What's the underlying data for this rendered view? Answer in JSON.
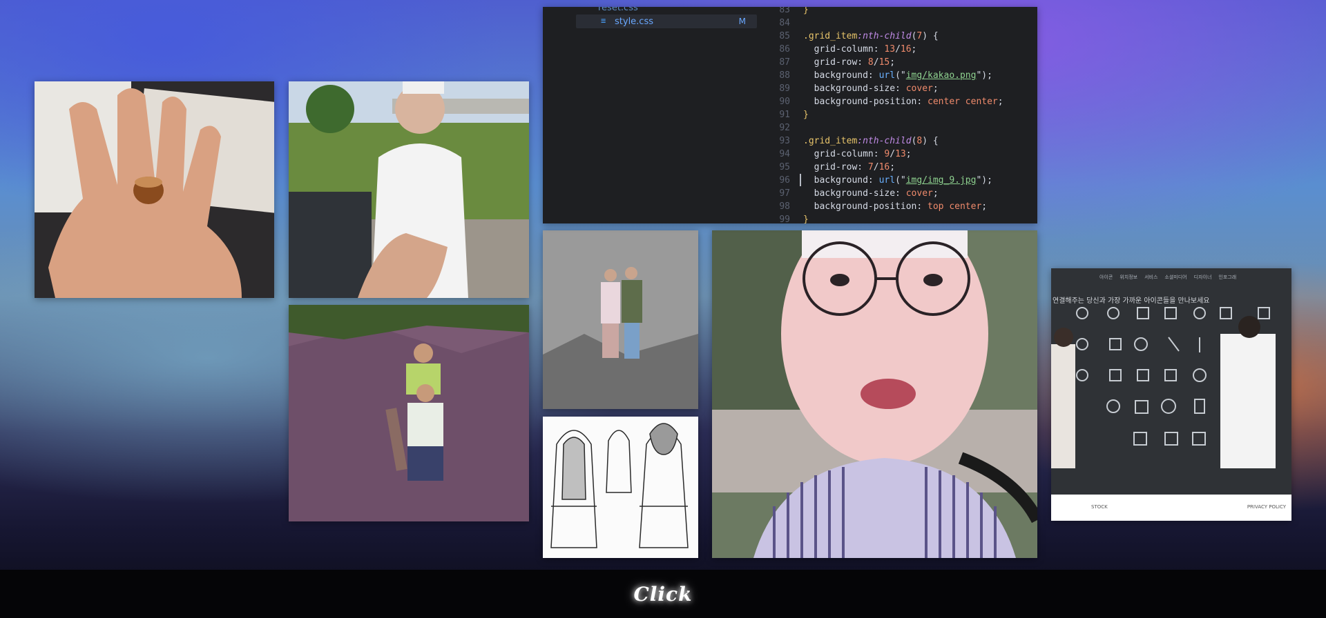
{
  "gallery": {
    "tiles": [
      {
        "name": "photo-hand-acorn"
      },
      {
        "name": "photo-riverbank-smile"
      },
      {
        "name": "photo-rocks-kids"
      },
      {
        "name": "photo-couple-rocks"
      },
      {
        "name": "sketch-coats"
      },
      {
        "name": "photo-selfie-glasses"
      },
      {
        "name": "screenshot-icon-site"
      }
    ]
  },
  "editor": {
    "explorer": {
      "top_partial": "reset.css",
      "file": "style.css",
      "git_status": "M"
    },
    "code_lines": [
      {
        "no": "83",
        "parts": [
          {
            "c": "t-brace",
            "t": "}"
          }
        ]
      },
      {
        "no": "84",
        "parts": []
      },
      {
        "no": "85",
        "parts": [
          {
            "c": "t-sel",
            "t": ".grid_item"
          },
          {
            "c": "t-pseudo",
            "t": ":nth-child"
          },
          {
            "c": "t-punc",
            "t": "("
          },
          {
            "c": "t-num",
            "t": "7"
          },
          {
            "c": "t-punc",
            "t": ") {"
          }
        ]
      },
      {
        "no": "86",
        "parts": [
          {
            "c": "t-prop",
            "t": "  grid-column: "
          },
          {
            "c": "t-num",
            "t": "13"
          },
          {
            "c": "t-punc",
            "t": "/"
          },
          {
            "c": "t-num",
            "t": "16"
          },
          {
            "c": "t-punc",
            "t": ";"
          }
        ]
      },
      {
        "no": "87",
        "parts": [
          {
            "c": "t-prop",
            "t": "  grid-row: "
          },
          {
            "c": "t-num",
            "t": "8"
          },
          {
            "c": "t-punc",
            "t": "/"
          },
          {
            "c": "t-num",
            "t": "15"
          },
          {
            "c": "t-punc",
            "t": ";"
          }
        ]
      },
      {
        "no": "88",
        "parts": [
          {
            "c": "t-prop",
            "t": "  background: "
          },
          {
            "c": "t-fn",
            "t": "url"
          },
          {
            "c": "t-punc",
            "t": "(\""
          },
          {
            "c": "t-str",
            "t": "img/kakao.png"
          },
          {
            "c": "t-punc",
            "t": "\");"
          }
        ]
      },
      {
        "no": "89",
        "parts": [
          {
            "c": "t-prop",
            "t": "  background-size: "
          },
          {
            "c": "t-kw",
            "t": "cover"
          },
          {
            "c": "t-punc",
            "t": ";"
          }
        ]
      },
      {
        "no": "90",
        "parts": [
          {
            "c": "t-prop",
            "t": "  background-position: "
          },
          {
            "c": "t-kw",
            "t": "center center"
          },
          {
            "c": "t-punc",
            "t": ";"
          }
        ]
      },
      {
        "no": "91",
        "parts": [
          {
            "c": "t-brace",
            "t": "}"
          }
        ]
      },
      {
        "no": "92",
        "parts": []
      },
      {
        "no": "93",
        "parts": [
          {
            "c": "t-sel",
            "t": ".grid_item"
          },
          {
            "c": "t-pseudo",
            "t": ":nth-child"
          },
          {
            "c": "t-punc",
            "t": "("
          },
          {
            "c": "t-num",
            "t": "8"
          },
          {
            "c": "t-punc",
            "t": ") {"
          }
        ]
      },
      {
        "no": "94",
        "parts": [
          {
            "c": "t-prop",
            "t": "  grid-column: "
          },
          {
            "c": "t-num",
            "t": "9"
          },
          {
            "c": "t-punc",
            "t": "/"
          },
          {
            "c": "t-num",
            "t": "13"
          },
          {
            "c": "t-punc",
            "t": ";"
          }
        ]
      },
      {
        "no": "95",
        "parts": [
          {
            "c": "t-prop",
            "t": "  grid-row: "
          },
          {
            "c": "t-num",
            "t": "7"
          },
          {
            "c": "t-punc",
            "t": "/"
          },
          {
            "c": "t-num",
            "t": "16"
          },
          {
            "c": "t-punc",
            "t": ";"
          }
        ]
      },
      {
        "no": "96",
        "parts": [
          {
            "c": "t-prop",
            "t": "  background: "
          },
          {
            "c": "t-fn",
            "t": "url"
          },
          {
            "c": "t-punc",
            "t": "(\""
          },
          {
            "c": "t-str",
            "t": "img/img_9.jpg"
          },
          {
            "c": "t-punc",
            "t": "\");"
          }
        ]
      },
      {
        "no": "97",
        "parts": [
          {
            "c": "t-prop",
            "t": "  background-size: "
          },
          {
            "c": "t-kw",
            "t": "cover"
          },
          {
            "c": "t-punc",
            "t": ";"
          }
        ]
      },
      {
        "no": "98",
        "parts": [
          {
            "c": "t-prop",
            "t": "  background-position: "
          },
          {
            "c": "t-kw",
            "t": "top center"
          },
          {
            "c": "t-punc",
            "t": ";"
          }
        ]
      },
      {
        "no": "99",
        "parts": [
          {
            "c": "t-brace",
            "t": "}"
          }
        ]
      }
    ]
  },
  "site_screenshot": {
    "nav_items": [
      "아이콘",
      "위치정보",
      "서비스",
      "소셜미디어",
      "디자이너",
      "인포그래"
    ],
    "headline": "연결해주는 당신과 가장 가까운 아이콘들을 만나보세요",
    "footer_left": "STOCK",
    "footer_right": "PRIVACY POLICY"
  },
  "footer": {
    "label": "Click"
  },
  "colors": {
    "editor_bg": "#1e1f22",
    "footer_bg": "#050507"
  }
}
